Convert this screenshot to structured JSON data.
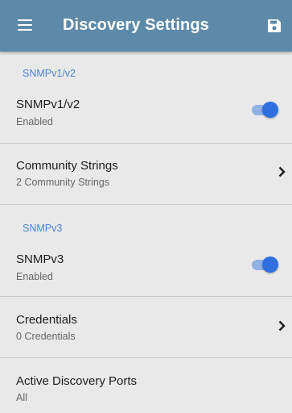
{
  "app_bar": {
    "title": "Discovery Settings",
    "menu_icon": "hamburger-menu-icon",
    "save_icon": "floppy-disk-save-icon",
    "background_color": "#5d8aa8"
  },
  "sections": {
    "snmpv1v2": {
      "header": "SNMPv1/v2",
      "toggle_row": {
        "title": "SNMPv1/v2",
        "status": "Enabled",
        "enabled": true
      },
      "community_row": {
        "title": "Community Strings",
        "subtitle": "2 Community Strings"
      }
    },
    "snmpv3": {
      "header": "SNMPv3",
      "toggle_row": {
        "title": "SNMPv3",
        "status": "Enabled",
        "enabled": true
      },
      "credentials_row": {
        "title": "Credentials",
        "subtitle": "0 Credentials"
      }
    },
    "ports": {
      "row": {
        "title": "Active Discovery Ports",
        "subtitle": "All"
      }
    }
  },
  "colors": {
    "accent": "#4a86d4",
    "toggle_thumb": "#2f6fe0",
    "toggle_track": "#8fb1e6",
    "background": "#e9e9e9"
  }
}
